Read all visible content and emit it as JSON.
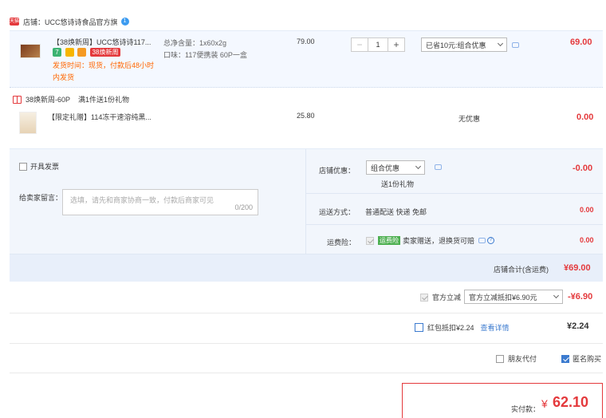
{
  "store": {
    "badge": "天猫",
    "label": "店铺：",
    "name": "UCC悠诗诗食品官方旗",
    "wangwang": "1"
  },
  "product": {
    "title": "【38焕新周】UCC悠诗诗117...",
    "tag_38": "38焕新周",
    "ship_note_line1": "发货时间：现货，付款后48小时",
    "ship_note_line2": "内发货",
    "attr_line1": "总净含量：1x60x2g",
    "attr_line2": "口味：117便携装 60P一盒",
    "unit_price": "79.00",
    "quantity": "1",
    "minus_label": "−",
    "plus_label": "+",
    "promo_select": "已省10元:组合优惠",
    "subtotal": "69.00"
  },
  "gift_header": {
    "title": "38焕新周-60P",
    "rule": "满1件送1份礼物"
  },
  "gift_item": {
    "title": "【限定礼赠】114冻干速溶纯黑...",
    "unit_price": "25.80",
    "promo": "无优惠",
    "subtotal": "0.00"
  },
  "options": {
    "invoice_label": "开具发票",
    "memo_label": "给卖家留言：",
    "memo_placeholder": "选填，请先和商家协商一致，付款后商家可见",
    "memo_counter": "0/200",
    "store_promo_label": "店铺优惠：",
    "store_promo_select": "组合优惠",
    "store_promo_sub": "送1份礼物",
    "store_promo_amount": "-0.00",
    "shipping_label": "运送方式：",
    "shipping_value": "普通配送 快递 免邮",
    "shipping_amount": "0.00",
    "insurance_label": "运费险：",
    "insurance_tag": "运费险",
    "insurance_text": "卖家赠送，退换货可赔",
    "insurance_amount": "0.00"
  },
  "store_total": {
    "label": "店铺合计(含运费)",
    "amount": "¥69.00"
  },
  "discounts": {
    "official_label": "官方立减",
    "official_select": "官方立减抵扣¥6.90元",
    "official_amount": "-¥6.90",
    "redpacket_label": "红包抵扣¥2.24",
    "redpacket_link": "查看详情",
    "redpacket_amount": "¥2.24",
    "friend_pay_label": "朋友代付",
    "anonymous_label": "匿名购买"
  },
  "payment": {
    "label": "实付款：",
    "currency": "¥",
    "amount": "62.10"
  },
  "colors": {
    "accent_red": "#e4393c",
    "link_blue": "#3c7bcf",
    "panel_bg": "#f2f6fc"
  }
}
